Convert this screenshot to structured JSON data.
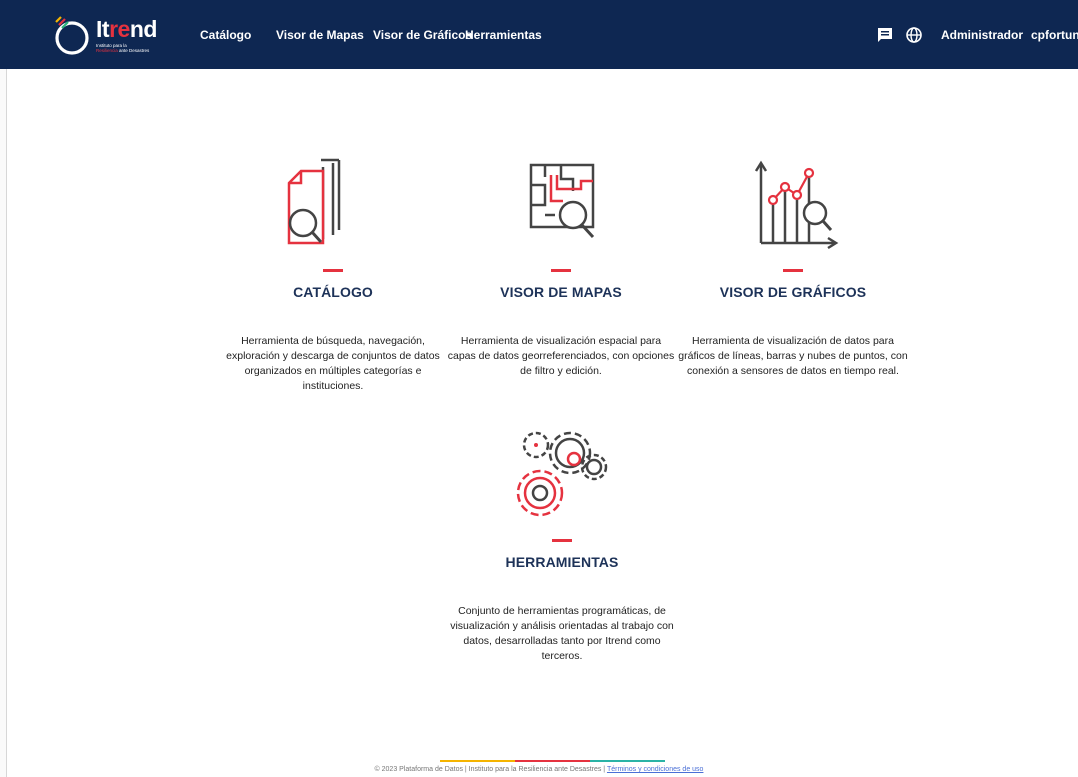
{
  "brand": {
    "name_prefix": "It",
    "name_accent": "re",
    "name_suffix": "nd",
    "subtitle_line1": "Instituto para la",
    "subtitle_line2_accent": "Resiliencia",
    "subtitle_line2": " ante Desastres",
    "colors": {
      "nav_bg": "#0e2752",
      "accent": "#e5323f",
      "title": "#1d3258"
    }
  },
  "nav": {
    "items": [
      {
        "label": "Catálogo"
      },
      {
        "label": "Visor de Mapas"
      },
      {
        "label": "Visor de Gráficos"
      },
      {
        "label": "Herramientas"
      }
    ],
    "right": {
      "chat_icon": "chat-icon",
      "language_icon": "globe-icon",
      "admin_label": "Administrador",
      "user_label": "cpfortun"
    }
  },
  "cards": [
    {
      "title": "CATÁLOGO",
      "icon": "documents-search-icon",
      "description": "Herramienta de búsqueda, navegación, exploración y descarga de conjuntos de datos organizados en múltiples categorías e instituciones."
    },
    {
      "title": "VISOR DE MAPAS",
      "icon": "map-search-icon",
      "description": "Herramienta de visualización espacial para capas de datos georreferenciados, con opciones de filtro y edición."
    },
    {
      "title": "VISOR DE GRÁFICOS",
      "icon": "chart-search-icon",
      "description": "Herramienta de visualización de datos para gráficos de líneas, barras y nubes de puntos, con conexión a sensores de datos en tiempo real."
    },
    {
      "title": "HERRAMIENTAS",
      "icon": "gears-icon",
      "description": "Conjunto de herramientas programáticas, de visualización y análisis orientadas al trabajo con datos, desarrolladas tanto por Itrend como terceros."
    }
  ],
  "footer": {
    "text": "© 2023 Plataforma de Datos | Instituto para la Resiliencia ante Desastres | ",
    "link_label": "Términos y condiciones de uso"
  }
}
